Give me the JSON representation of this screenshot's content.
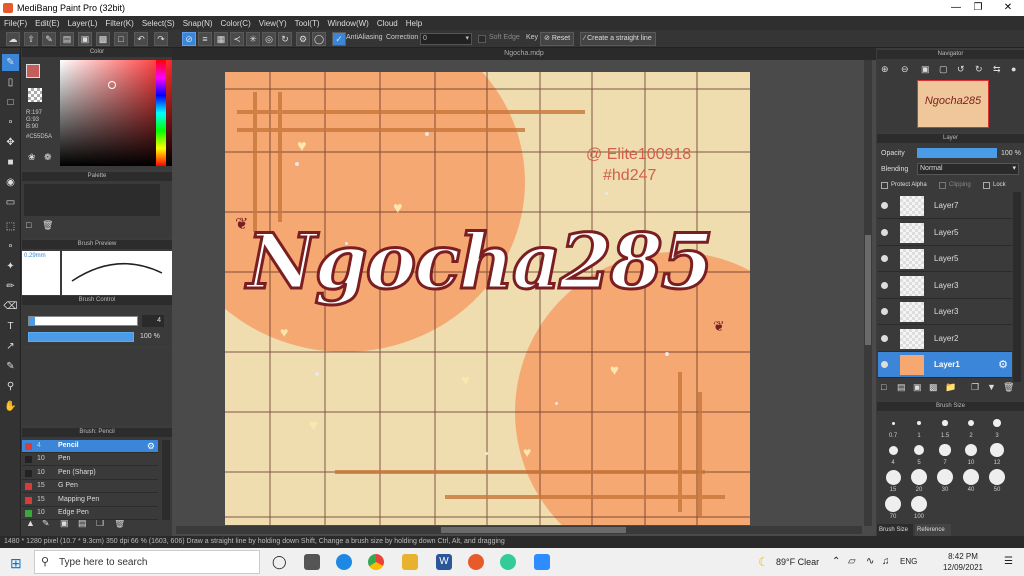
{
  "window": {
    "title": "MediBang Paint Pro (32bit)"
  },
  "menu": [
    "File(F)",
    "Edit(E)",
    "Layer(L)",
    "Filter(K)",
    "Select(S)",
    "Snap(N)",
    "Color(C)",
    "View(Y)",
    "Tool(T)",
    "Window(W)",
    "Cloud",
    "Help"
  ],
  "toolbar": {
    "antialias_label": "AntiAliasing",
    "correction_label": "Correction",
    "correction_value": "0",
    "soft_edge_label": "Soft Edge",
    "key_label": "Key",
    "reset_label": "Reset",
    "straight_line_label": "Create a straight line"
  },
  "color_panel": {
    "title": "Color",
    "r": "R:197",
    "g": "G:93",
    "b": "B:90",
    "hex": "#C55D5A",
    "fg_color": "#c55d5a"
  },
  "palette_panel": {
    "title": "Palette"
  },
  "brush_preview": {
    "title": "Brush Preview",
    "size": "0.29mm"
  },
  "brush_control": {
    "title": "Brush Control",
    "size_value": "4",
    "opacity_value": "100 %"
  },
  "brush_list": {
    "title": "Brush: Pencil",
    "items": [
      {
        "size": "4",
        "name": "Pencil",
        "color": "#d93b3b",
        "selected": true
      },
      {
        "size": "10",
        "name": "Pen",
        "color": "#222222"
      },
      {
        "size": "10",
        "name": "Pen (Sharp)",
        "color": "#222222"
      },
      {
        "size": "15",
        "name": "G Pen",
        "color": "#d93b3b"
      },
      {
        "size": "15",
        "name": "Mapping Pen",
        "color": "#d93b3b"
      },
      {
        "size": "10",
        "name": "Edge Pen",
        "color": "#3aa83a"
      }
    ]
  },
  "document": {
    "tab": "Ngocha.mdp"
  },
  "artwork": {
    "credit_line1": "@ Elite100918",
    "credit_line2": "#hd247",
    "main_text": "Ngocha285"
  },
  "navigator": {
    "title": "Navigator"
  },
  "layer_panel": {
    "title": "Layer",
    "opacity_label": "Opacity",
    "opacity_value": "100 %",
    "blending_label": "Blending",
    "blending_value": "Normal",
    "protect_alpha": "Protect Alpha",
    "clipping": "Clipping",
    "lock": "Lock",
    "layers": [
      {
        "name": "Layer7",
        "selected": false
      },
      {
        "name": "Layer5",
        "selected": false
      },
      {
        "name": "Layer5",
        "selected": false
      },
      {
        "name": "Layer3",
        "selected": false
      },
      {
        "name": "Layer3",
        "selected": false
      },
      {
        "name": "Layer2",
        "selected": false
      },
      {
        "name": "Layer1",
        "selected": true
      }
    ]
  },
  "brush_size_panel": {
    "title": "Brush Size",
    "sizes": [
      "0.7",
      "1",
      "1.5",
      "2",
      "3",
      "4",
      "5",
      "7",
      "10",
      "12",
      "15",
      "20",
      "30",
      "40",
      "50",
      "70",
      "100"
    ],
    "tab1": "Brush Size",
    "tab2": "Reference"
  },
  "status": {
    "text": "1480 * 1280 pixel  (10.7 * 9.3cm)  350 dpi  66 %  (1603, 606)  Draw a straight line by holding down Shift, Change a brush size by holding down Ctrl, Alt, and dragging"
  },
  "taskbar": {
    "search_placeholder": "Type here to search",
    "weather": "89°F  Clear",
    "lang": "ENG",
    "time": "8:42 PM",
    "date": "12/09/2021"
  }
}
